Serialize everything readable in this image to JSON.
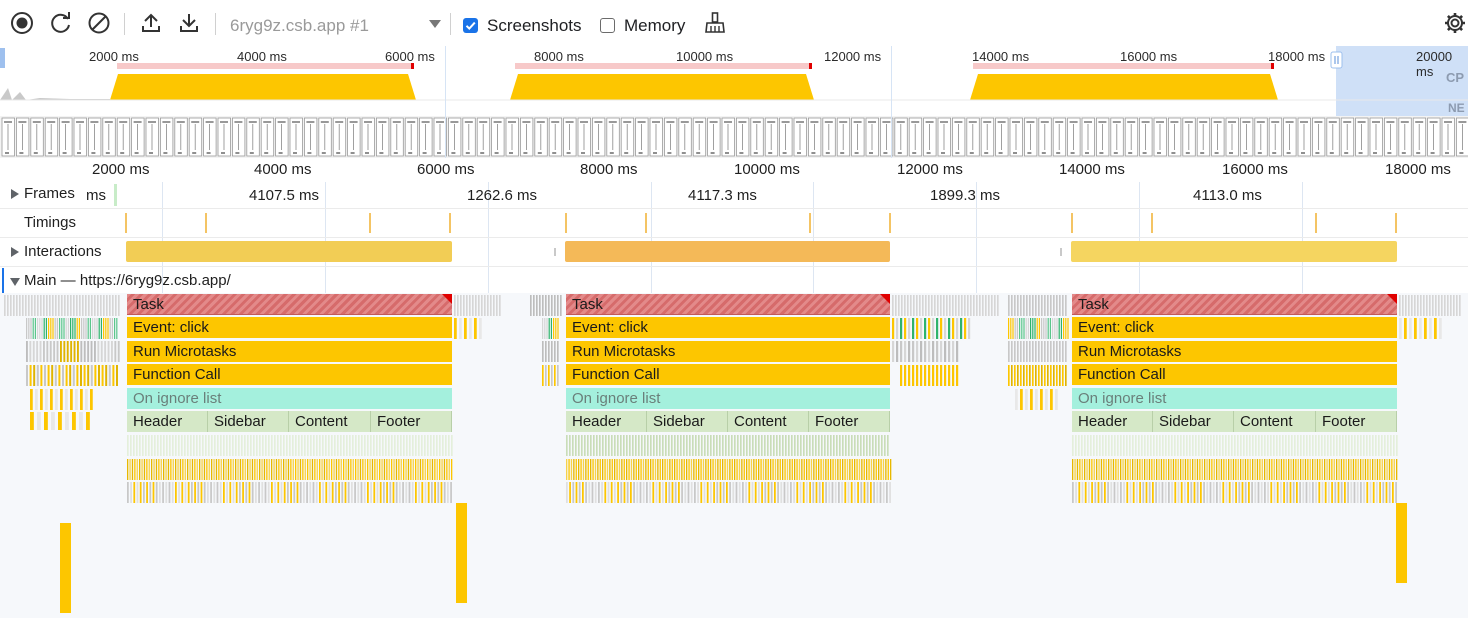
{
  "toolbar": {
    "record_icon": "record-icon",
    "reload_icon": "reload-icon",
    "clear_icon": "clear-icon",
    "upload_icon": "upload-icon",
    "download_icon": "download-icon",
    "target": "6ryg9z.csb.app #1",
    "screenshots_label": "Screenshots",
    "screenshots_checked": true,
    "memory_label": "Memory",
    "memory_checked": false,
    "garbage_icon": "broom-icon",
    "settings_icon": "gear-icon"
  },
  "overview": {
    "ticks": [
      "2000 ms",
      "4000 ms",
      "6000 ms",
      "8000 ms",
      "10000 ms",
      "12000 ms",
      "14000 ms",
      "16000 ms",
      "18000 ms",
      "20000 ms"
    ],
    "cpu_label": "CP",
    "net_label": "NE"
  },
  "ruler": {
    "ticks": [
      "2000 ms",
      "4000 ms",
      "6000 ms",
      "8000 ms",
      "10000 ms",
      "12000 ms",
      "14000 ms",
      "16000 ms",
      "18000 ms"
    ]
  },
  "tracks": {
    "frames_label": "Frames",
    "frames_durations": [
      "ms",
      "4107.5 ms",
      "1262.6 ms",
      "4117.3 ms",
      "1899.3 ms",
      "4113.0 ms"
    ],
    "timings_label": "Timings",
    "interactions_label": "Interactions",
    "main_label": "Main — https://6ryg9z.csb.app/"
  },
  "flame": {
    "task": "Task",
    "event": "Event: click",
    "microtasks": "Run Microtasks",
    "function_call": "Function Call",
    "ignore": "On ignore list",
    "components": [
      "Header",
      "Sidebar",
      "Content",
      "Footer"
    ]
  },
  "colors": {
    "accent": "#1a73e8",
    "scripting": "#fdc600",
    "task": "#e38a8a",
    "ignore": "#a4f0dd",
    "component": "#d5e8c7",
    "selection": "#cfe0f7"
  }
}
